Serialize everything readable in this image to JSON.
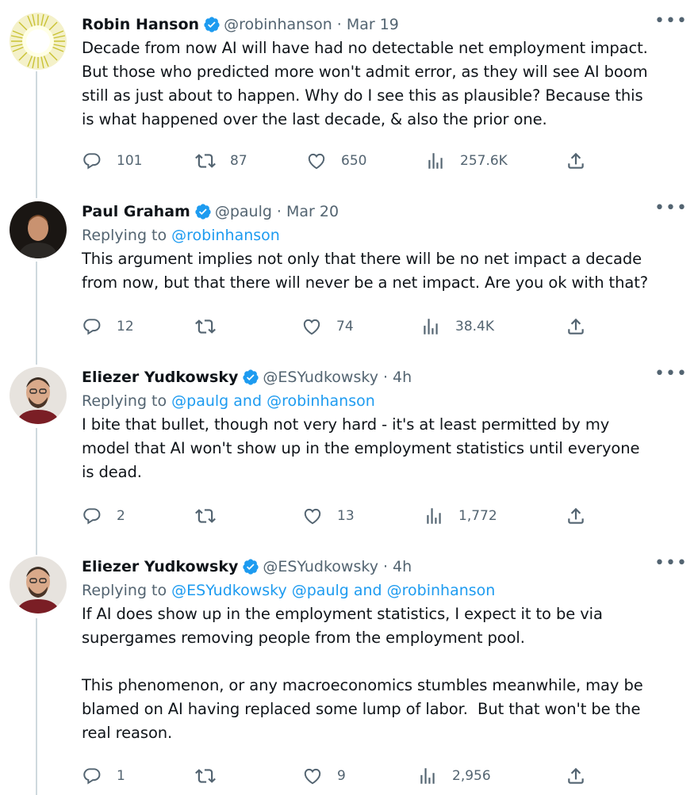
{
  "tweets": [
    {
      "name": "Robin Hanson",
      "handle": "@robinhanson",
      "separator": "·",
      "date": "Mar 19",
      "more": "•••",
      "replying_to": null,
      "text": "Decade from now AI will have had no detectable net employment impact.\nBut those who predicted more won't admit error, as they will see AI boom\nstill as just about to happen. Why do I see this as plausible? Because this\nis what happened over the last decade, & also the prior one.",
      "stats": {
        "replies": "101",
        "retweets": "87",
        "likes": "650",
        "views": "257.6K"
      },
      "avatar": "sun-burst-avatar"
    },
    {
      "name": "Paul Graham",
      "handle": "@paulg",
      "separator": "·",
      "date": "Mar 20",
      "more": "•••",
      "replying_prefix": "Replying to ",
      "replying_to": "@robinhanson",
      "text": "This argument implies not only that there will be no net impact a decade\nfrom now, but that there will never be a net impact. Are you ok with that?",
      "stats": {
        "replies": "12",
        "retweets": "",
        "likes": "74",
        "views": "38.4K"
      },
      "avatar": "portrait-avatar"
    },
    {
      "name": "Eliezer Yudkowsky",
      "handle": "@ESYudkowsky",
      "separator": "·",
      "date": "4h",
      "more": "•••",
      "replying_prefix": "Replying to ",
      "replying_to": "@paulg and @robinhanson",
      "text": "I bite that bullet, though not very hard - it's at least permitted by my\nmodel that AI won't show up in the employment statistics until everyone\nis dead.",
      "stats": {
        "replies": "2",
        "retweets": "",
        "likes": "13",
        "views": "1,772"
      },
      "avatar": "portrait-avatar"
    },
    {
      "name": "Eliezer Yudkowsky",
      "handle": "@ESYudkowsky",
      "separator": "·",
      "date": "4h",
      "more": "•••",
      "replying_prefix": "Replying to ",
      "replying_to": "@ESYudkowsky @paulg and @robinhanson",
      "text": "If AI does show up in the employment statistics, I expect it to be via\nsupergames removing people from the employment pool.\n\nThis phenomenon, or any macroeconomics stumbles meanwhile, may be\nblamed on AI having replaced some lump of labor.  But that won't be the\nreal reason.",
      "stats": {
        "replies": "1",
        "retweets": "",
        "likes": "9",
        "views": "2,956"
      },
      "avatar": "portrait-avatar"
    }
  ],
  "colors": {
    "accent": "#1d9bf0",
    "muted": "#536471",
    "text": "#0f1419",
    "thread_line": "#cfd9de"
  }
}
